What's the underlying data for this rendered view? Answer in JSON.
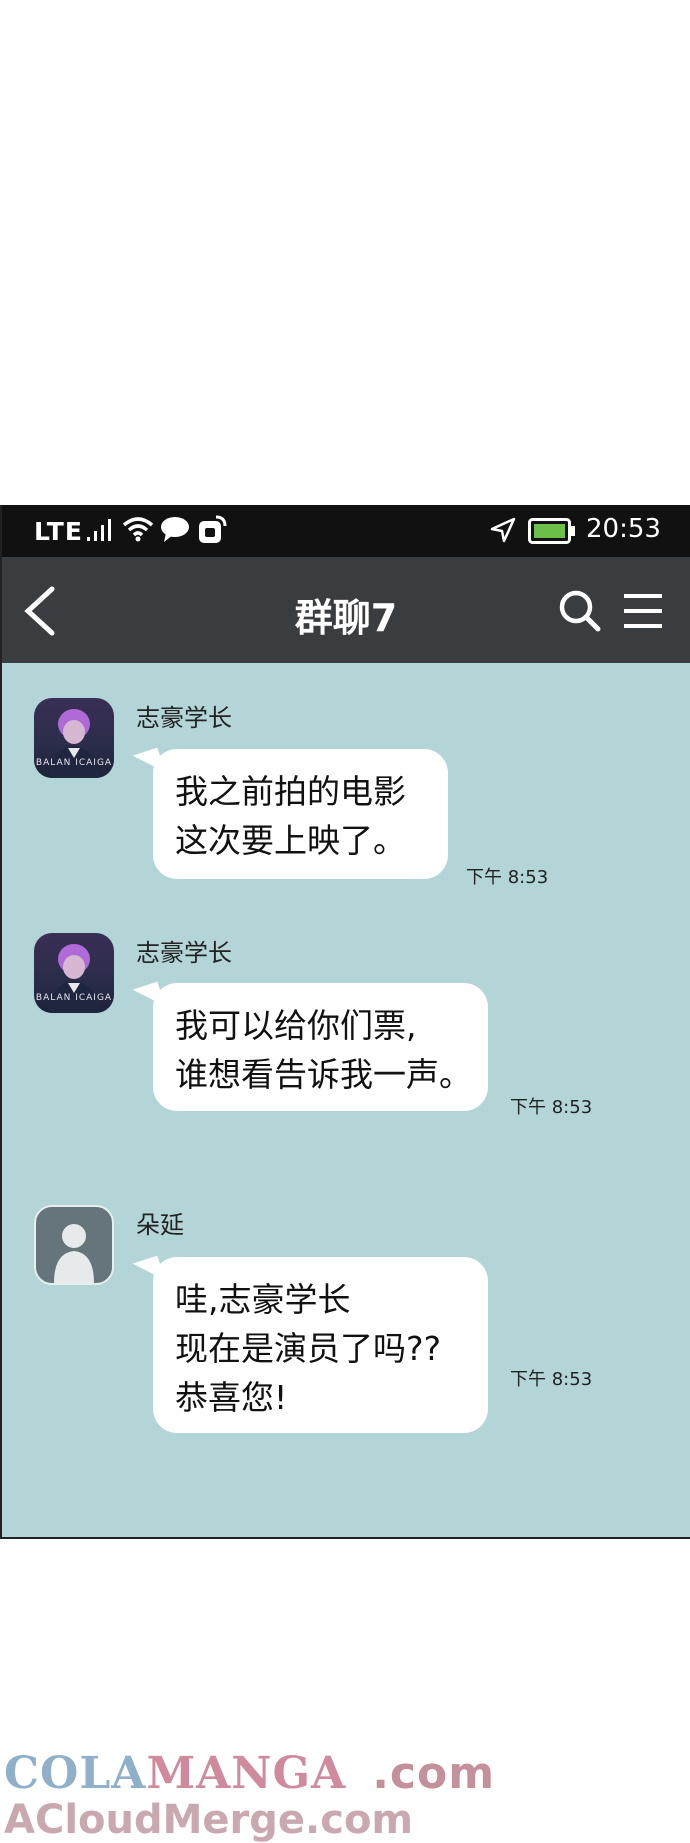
{
  "status_bar": {
    "network": "LTE",
    "time": "20:53"
  },
  "header": {
    "title": "群聊7"
  },
  "messages": [
    {
      "sender": "志豪学长",
      "avatar_text": "BALAN  ICAIGA",
      "lines": [
        "我之前拍的电影",
        "这次要上映了。"
      ],
      "time": "下午 8:53"
    },
    {
      "sender": "志豪学长",
      "avatar_text": "BALAN  ICAIGA",
      "lines": [
        "我可以给你们票,",
        "谁想看告诉我一声。"
      ],
      "time": "下午 8:53"
    },
    {
      "sender": "朵延",
      "lines": [
        "哇,志豪学长",
        "现在是演员了吗??",
        "恭喜您!"
      ],
      "time": "下午 8:53"
    }
  ],
  "watermark": {
    "line1_a": "COLA",
    "line1_b": "MANGA",
    "line1_c": ".com",
    "line2": "ACloudMerge.com"
  },
  "colors": {
    "chat_bg": "#b3d5d8",
    "header_bg": "#3a3d40",
    "statusbar_bg": "#111111",
    "battery": "#6cc04a"
  }
}
